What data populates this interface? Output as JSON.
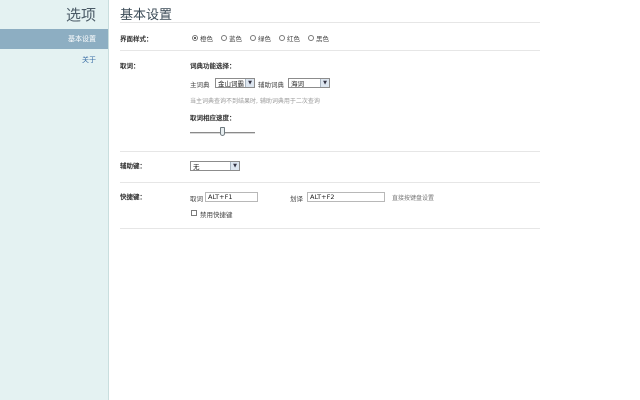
{
  "sidebar": {
    "title": "选项",
    "items": [
      {
        "label": "基本设置",
        "active": true
      },
      {
        "label": "关于",
        "active": false
      }
    ]
  },
  "main": {
    "title": "基本设置",
    "theme": {
      "label": "界面样式：",
      "options": [
        "橙色",
        "蓝色",
        "绿色",
        "红色",
        "黑色"
      ],
      "selected": "橙色"
    },
    "lookup": {
      "label": "取词：",
      "dict_section_label": "词典功能选择：",
      "main_dict_label": "主词典",
      "main_dict_value": "金山词霸",
      "aux_dict_label": "辅助词典",
      "aux_dict_value": "海词",
      "hint": "当主词典查询不到结果时, 辅助词典用于二次查询",
      "speed_label": "取词相应速度：",
      "speed_level": 0.5
    },
    "modifier": {
      "label": "辅助键：",
      "value": "无"
    },
    "hotkeys": {
      "label": "快捷键：",
      "lookup_label": "取词",
      "lookup_value": "ALT+F1",
      "select_label": "划译",
      "select_value": "ALT+F2",
      "reset_link": "直接按键盘设置",
      "disable_label": "禁用快捷键"
    }
  },
  "colors": {
    "sidebar_bg": "#e4f2f2",
    "nav_active_bg": "#8daec2",
    "link": "#3a6ea5"
  }
}
